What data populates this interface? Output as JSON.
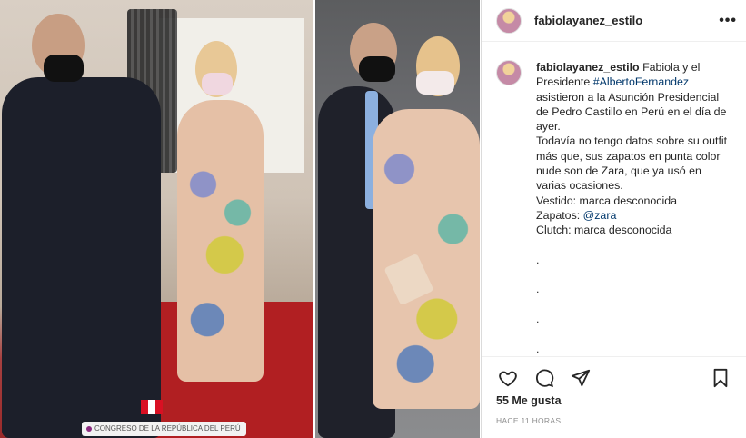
{
  "post": {
    "username": "fabiolayanez_estilo",
    "more_glyph": "•••",
    "photo_caption_tag": "CONGRESO DE LA REPÚBLICA DEL PERÚ"
  },
  "caption": {
    "username": "fabiolayanez_estilo",
    "text_1": " Fabiola y el Presidente ",
    "hashtag": "#AlbertoFernandez",
    "text_2": " asistieron a la Asunción Presidencial de Pedro Castillo en Perú en el día de ayer.",
    "line_2": "Todavía no tengo datos sobre su outfit más que, sus zapatos en punta color nude son de Zara, que ya usó en varias ocasiones.",
    "vestido": "Vestido: marca desconocida",
    "zapatos_label": "Zapatos: ",
    "zapatos_mention": "@zara",
    "clutch": "Clutch: marca desconocida",
    "dots": [
      ".",
      ".",
      ".",
      "."
    ]
  },
  "actions": {
    "icons": [
      "heart-icon",
      "comment-icon",
      "share-icon",
      "bookmark-icon"
    ]
  },
  "stats": {
    "likes": "55 Me gusta",
    "time": "HACE 11 HORAS"
  }
}
